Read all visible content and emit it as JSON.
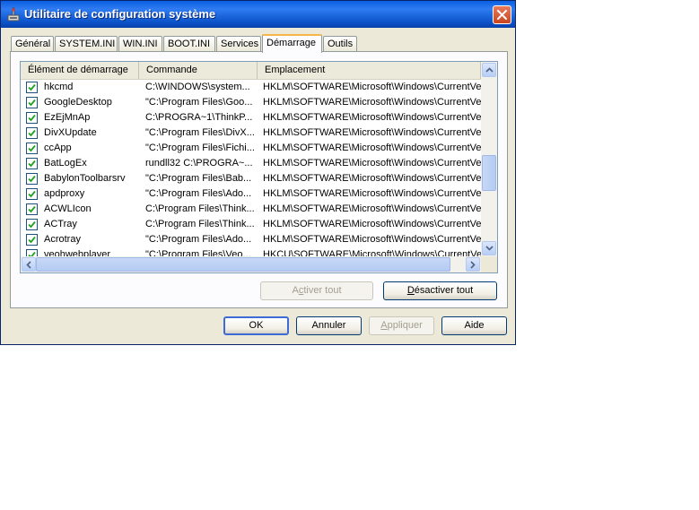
{
  "window": {
    "title": "Utilitaire de configuration système"
  },
  "tabs": [
    {
      "label": "Général",
      "active": false
    },
    {
      "label": "SYSTEM.INI",
      "active": false
    },
    {
      "label": "WIN.INI",
      "active": false
    },
    {
      "label": "BOOT.INI",
      "active": false
    },
    {
      "label": "Services",
      "active": false
    },
    {
      "label": "Démarrage",
      "active": true
    },
    {
      "label": "Outils",
      "active": false
    }
  ],
  "startup_list": {
    "columns": [
      "Élément de démarrage",
      "Commande",
      "Emplacement"
    ],
    "rows": [
      {
        "checked": true,
        "item": "hkcmd",
        "command": "C:\\WINDOWS\\system...",
        "location": "HKLM\\SOFTWARE\\Microsoft\\Windows\\CurrentVer..."
      },
      {
        "checked": true,
        "item": "GoogleDesktop",
        "command": "\"C:\\Program Files\\Goo...",
        "location": "HKLM\\SOFTWARE\\Microsoft\\Windows\\CurrentVer..."
      },
      {
        "checked": true,
        "item": "EzEjMnAp",
        "command": "C:\\PROGRA~1\\ThinkP...",
        "location": "HKLM\\SOFTWARE\\Microsoft\\Windows\\CurrentVer..."
      },
      {
        "checked": true,
        "item": "DivXUpdate",
        "command": "\"C:\\Program Files\\DivX...",
        "location": "HKLM\\SOFTWARE\\Microsoft\\Windows\\CurrentVer..."
      },
      {
        "checked": true,
        "item": "ccApp",
        "command": "\"C:\\Program Files\\Fichi...",
        "location": "HKLM\\SOFTWARE\\Microsoft\\Windows\\CurrentVer..."
      },
      {
        "checked": true,
        "item": "BatLogEx",
        "command": "rundll32 C:\\PROGRA~...",
        "location": "HKLM\\SOFTWARE\\Microsoft\\Windows\\CurrentVer..."
      },
      {
        "checked": true,
        "item": "BabylonToolbarsrv",
        "command": "\"C:\\Program Files\\Bab...",
        "location": "HKLM\\SOFTWARE\\Microsoft\\Windows\\CurrentVer..."
      },
      {
        "checked": true,
        "item": "apdproxy",
        "command": "\"C:\\Program Files\\Ado...",
        "location": "HKLM\\SOFTWARE\\Microsoft\\Windows\\CurrentVer..."
      },
      {
        "checked": true,
        "item": "ACWLIcon",
        "command": "C:\\Program Files\\Think...",
        "location": "HKLM\\SOFTWARE\\Microsoft\\Windows\\CurrentVer..."
      },
      {
        "checked": true,
        "item": "ACTray",
        "command": "C:\\Program Files\\Think...",
        "location": "HKLM\\SOFTWARE\\Microsoft\\Windows\\CurrentVer..."
      },
      {
        "checked": true,
        "item": "Acrotray",
        "command": "\"C:\\Program Files\\Ado...",
        "location": "HKLM\\SOFTWARE\\Microsoft\\Windows\\CurrentVer..."
      },
      {
        "checked": true,
        "item": "veohwebplayer",
        "command": "\"C:\\Program Files\\Veo...",
        "location": "HKCU\\SOFTWARE\\Microsoft\\Windows\\CurrentVer..."
      }
    ]
  },
  "buttons": {
    "enable_all": {
      "pre": "A",
      "accel": "c",
      "post": "tiver tout"
    },
    "disable_all": {
      "pre": "",
      "accel": "D",
      "post": "ésactiver tout"
    },
    "ok": "OK",
    "cancel": "Annuler",
    "apply": {
      "pre": "",
      "accel": "A",
      "post": "ppliquer"
    },
    "help": "Aide"
  },
  "colors": {
    "titlebar": "#0b52c9",
    "active_tab_accent": "#f7b64a",
    "checkbox_check": "#21a121"
  }
}
